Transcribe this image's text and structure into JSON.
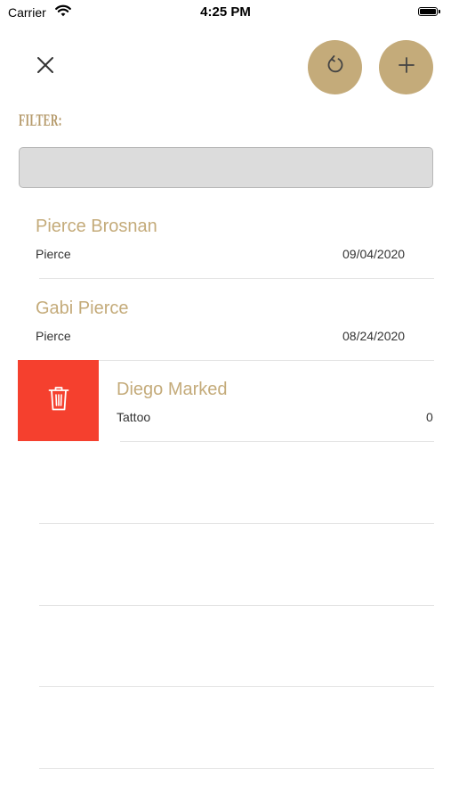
{
  "status_bar": {
    "carrier": "Carrier",
    "time": "4:25 PM"
  },
  "header": {
    "close_icon": "close-icon",
    "refresh_icon": "refresh-icon",
    "add_icon": "plus-icon",
    "accent_color": "#c4ab7a"
  },
  "filter": {
    "label": "FILTER:",
    "value": "",
    "placeholder": ""
  },
  "list": {
    "items": [
      {
        "name": "Pierce Brosnan",
        "type": "Pierce",
        "date": "09/04/2020"
      },
      {
        "name": "Gabi Pierce",
        "type": "Pierce",
        "date": "08/24/2020"
      },
      {
        "name": "Diego Marked",
        "type": "Tattoo",
        "date": "0"
      }
    ],
    "delete_action": {
      "icon": "trash-icon",
      "color": "#f5402e"
    }
  }
}
